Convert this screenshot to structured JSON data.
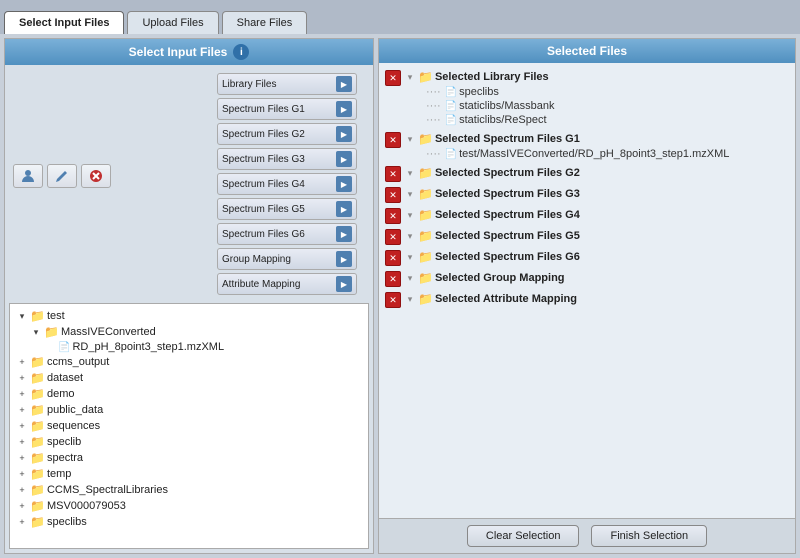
{
  "tabs": [
    {
      "label": "Select Input Files",
      "active": true
    },
    {
      "label": "Upload Files",
      "active": false
    },
    {
      "label": "Share Files",
      "active": false
    }
  ],
  "left_panel": {
    "header": "Select Input Files",
    "info_icon": "i",
    "toolbar_icons": [
      {
        "name": "user-icon",
        "symbol": "👤"
      },
      {
        "name": "edit-icon",
        "symbol": "✏"
      },
      {
        "name": "delete-icon",
        "symbol": "✕"
      }
    ],
    "category_buttons": [
      {
        "label": "Library Files",
        "name": "library-files-btn"
      },
      {
        "label": "Spectrum Files G1",
        "name": "spectrum-g1-btn"
      },
      {
        "label": "Spectrum Files G2",
        "name": "spectrum-g2-btn"
      },
      {
        "label": "Spectrum Files G3",
        "name": "spectrum-g3-btn"
      },
      {
        "label": "Spectrum Files G4",
        "name": "spectrum-g4-btn"
      },
      {
        "label": "Spectrum Files G5",
        "name": "spectrum-g5-btn"
      },
      {
        "label": "Spectrum Files G6",
        "name": "spectrum-g6-btn"
      },
      {
        "label": "Group Mapping",
        "name": "group-mapping-btn"
      },
      {
        "label": "Attribute Mapping",
        "name": "attribute-mapping-btn"
      }
    ],
    "file_tree": [
      {
        "indent": 0,
        "type": "folder",
        "label": "test",
        "expanded": true,
        "has_toggle": true,
        "toggle": "▾"
      },
      {
        "indent": 1,
        "type": "folder",
        "label": "MassIVEConverted",
        "expanded": true,
        "has_toggle": true,
        "toggle": "▾"
      },
      {
        "indent": 2,
        "type": "file",
        "label": "RD_pH_8point3_step1.mzXML",
        "has_toggle": false
      },
      {
        "indent": 0,
        "type": "folder",
        "label": "ccms_output",
        "expanded": false,
        "has_toggle": true,
        "toggle": "+"
      },
      {
        "indent": 0,
        "type": "folder",
        "label": "dataset",
        "expanded": false,
        "has_toggle": true,
        "toggle": "+"
      },
      {
        "indent": 0,
        "type": "folder",
        "label": "demo",
        "expanded": false,
        "has_toggle": true,
        "toggle": "+"
      },
      {
        "indent": 0,
        "type": "folder",
        "label": "public_data",
        "expanded": false,
        "has_toggle": true,
        "toggle": "+"
      },
      {
        "indent": 0,
        "type": "folder",
        "label": "sequences",
        "expanded": false,
        "has_toggle": true,
        "toggle": "+"
      },
      {
        "indent": 0,
        "type": "folder",
        "label": "speclib",
        "expanded": false,
        "has_toggle": true,
        "toggle": "+"
      },
      {
        "indent": 0,
        "type": "folder",
        "label": "spectra",
        "expanded": false,
        "has_toggle": true,
        "toggle": "+"
      },
      {
        "indent": 0,
        "type": "folder",
        "label": "temp",
        "expanded": false,
        "has_toggle": true,
        "toggle": "+"
      },
      {
        "indent": 0,
        "type": "folder",
        "label": "CCMS_SpectralLibraries",
        "expanded": false,
        "has_toggle": true,
        "toggle": "+"
      },
      {
        "indent": 0,
        "type": "folder",
        "label": "MSV000079053",
        "expanded": false,
        "has_toggle": true,
        "toggle": "+"
      },
      {
        "indent": 0,
        "type": "folder",
        "label": "speclibs",
        "expanded": false,
        "has_toggle": true,
        "toggle": "+"
      }
    ]
  },
  "right_panel": {
    "header": "Selected Files",
    "sections": [
      {
        "category": "Selected Library Files",
        "files": [
          "speclibs",
          "staticlibs/Massbank",
          "staticlibs/ReSpect"
        ]
      },
      {
        "category": "Selected Spectrum Files G1",
        "files": [
          "test/MassIVEConverted/RD_pH_8point3_step1.mzXML"
        ]
      },
      {
        "category": "Selected Spectrum Files G2",
        "files": []
      },
      {
        "category": "Selected Spectrum Files G3",
        "files": []
      },
      {
        "category": "Selected Spectrum Files G4",
        "files": []
      },
      {
        "category": "Selected Spectrum Files G5",
        "files": []
      },
      {
        "category": "Selected Spectrum Files G6",
        "files": []
      },
      {
        "category": "Selected Group Mapping",
        "files": []
      },
      {
        "category": "Selected Attribute Mapping",
        "files": []
      }
    ],
    "buttons": {
      "clear": "Clear Selection",
      "finish": "Finish Selection"
    }
  }
}
